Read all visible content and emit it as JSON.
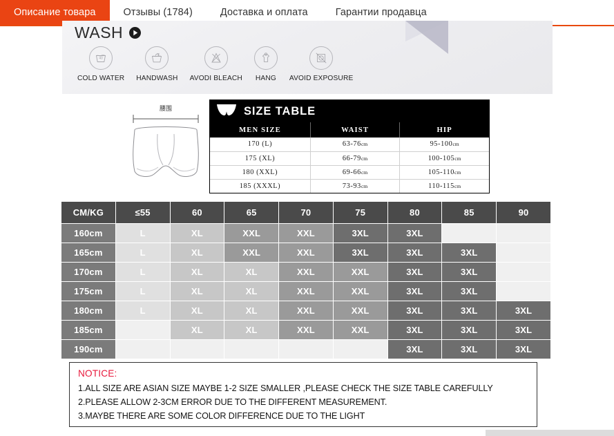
{
  "tabs": [
    {
      "label": "Описание товара",
      "active": true
    },
    {
      "label": "Отзывы (1784)",
      "active": false
    },
    {
      "label": "Доставка и оплата",
      "active": false
    },
    {
      "label": "Гарантии продавца",
      "active": false
    }
  ],
  "wash": {
    "heading": "WASH",
    "play_icon": "play-icon",
    "items": [
      {
        "label": "COLD WATER",
        "icon": "cold-water-icon"
      },
      {
        "label": "HANDWASH",
        "icon": "handwash-icon"
      },
      {
        "label": "AVODI BLEACH",
        "icon": "no-bleach-icon"
      },
      {
        "label": "HANG",
        "icon": "hang-dry-icon"
      },
      {
        "label": "AVOID EXPOSURE",
        "icon": "no-sun-exposure-icon"
      }
    ]
  },
  "garment": {
    "measure_label": "腰围",
    "icon": "boxer-briefs-diagram"
  },
  "size_table": {
    "title": "SIZE TABLE",
    "title_icon": "briefs-icon",
    "headers": [
      "MEN SIZE",
      "WAIST",
      "HIP"
    ],
    "rows": [
      {
        "men_size": "170 (L)",
        "waist": "63-76",
        "waist_unit": "cm",
        "hip": "95-100",
        "hip_unit": "cm"
      },
      {
        "men_size": "175 (XL)",
        "waist": "66-79",
        "waist_unit": "cm",
        "hip": "100-105",
        "hip_unit": "cm"
      },
      {
        "men_size": "180 (XXL)",
        "waist": "69-66",
        "waist_unit": "cm",
        "hip": "105-110",
        "hip_unit": "cm"
      },
      {
        "men_size": "185 (XXXL)",
        "waist": "73-93",
        "waist_unit": "cm",
        "hip": "110-115",
        "hip_unit": "cm"
      }
    ]
  },
  "size_grid": {
    "corner_label": "CM/KG",
    "weight_columns": [
      "≤55",
      "60",
      "65",
      "70",
      "75",
      "80",
      "85",
      "90"
    ],
    "heights": [
      "160cm",
      "165cm",
      "170cm",
      "175cm",
      "180cm",
      "185cm",
      "190cm"
    ],
    "cells": [
      [
        "L",
        "XL",
        "XXL",
        "XXL",
        "3XL",
        "3XL",
        "",
        ""
      ],
      [
        "L",
        "XL",
        "XXL",
        "XXL",
        "3XL",
        "3XL",
        "3XL",
        ""
      ],
      [
        "L",
        "XL",
        "XL",
        "XXL",
        "XXL",
        "3XL",
        "3XL",
        ""
      ],
      [
        "L",
        "XL",
        "XL",
        "XXL",
        "XXL",
        "3XL",
        "3XL",
        ""
      ],
      [
        "L",
        "XL",
        "XL",
        "XXL",
        "XXL",
        "3XL",
        "3XL",
        "3XL"
      ],
      [
        "",
        "XL",
        "XL",
        "XXL",
        "XXL",
        "3XL",
        "3XL",
        "3XL"
      ],
      [
        "",
        "",
        "",
        "",
        "",
        "3XL",
        "3XL",
        "3XL"
      ]
    ]
  },
  "notice": {
    "title": "NOTICE:",
    "lines": [
      "1.ALL SIZE ARE ASIAN SIZE MAYBE 1-2 SIZE SMALLER ,PLEASE CHECK THE SIZE TABLE CAREFULLY",
      "2.PLEASE ALLOW 2-3CM ERROR DUE TO THE DIFFERENT MEASUREMENT.",
      "3.MAYBE THERE ARE SOME COLOR DIFFERENCE DUE TO THE LIGHT"
    ]
  },
  "colors": {
    "tab_active_bg": "#ea4413",
    "tab_underline": "#e8490f",
    "notice_title": "#e8193c",
    "grid_header": "#4a4a4a",
    "grid_rowheader": "#7b7b7b",
    "size_L": "#e0e0e0",
    "size_XL": "#c7c7c7",
    "size_XXL": "#9a9a9a",
    "size_3XL": "#6e6e6e",
    "size_empty": "#f0f0f0"
  }
}
